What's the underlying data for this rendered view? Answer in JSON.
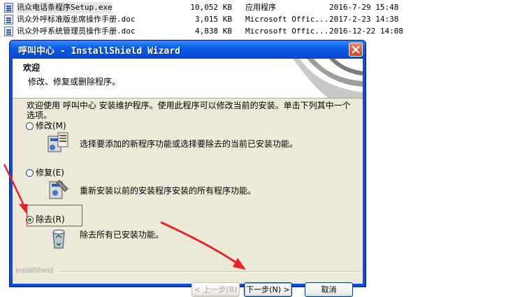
{
  "files": [
    {
      "name": "讯众电话条程序Setup.exe",
      "size": "10,052 KB",
      "type": "应用程序",
      "modified": "2016-7-29 15:48",
      "icon": "exe-file-icon",
      "selected": true
    },
    {
      "name": "讯众外呼标准版坐席操作手册.doc",
      "size": "3,015 KB",
      "type": "Microsoft Offic...",
      "modified": "2017-2-23 14:38",
      "icon": "word-doc-icon",
      "selected": false
    },
    {
      "name": "讯众外呼系统管理员操作手册.doc",
      "size": "4,838 KB",
      "type": "Microsoft Offic...",
      "modified": "2016-12-22 14:08",
      "icon": "word-doc-icon",
      "selected": false
    }
  ],
  "wizard": {
    "title": "呼叫中心 - InstallShield Wizard",
    "banner_heading": "欢迎",
    "banner_sub": "修改、修复或删除程序。",
    "intro": "欢迎使用 呼叫中心 安装维护程序。使用此程序可以修改当前的安装。单击下列其中一个选项。",
    "options": [
      {
        "label": "修改(M)",
        "description": "选择要添加的新程序功能或选择要除去的当前已安装功能。",
        "icon": "modify-setup-icon",
        "checked": false
      },
      {
        "label": "修复(E)",
        "description": "重新安装以前的安装程序安装的所有程序功能。",
        "icon": "repair-setup-icon",
        "checked": false
      },
      {
        "label": "除去(R)",
        "description": "除去所有已安装功能。",
        "icon": "remove-recycle-icon",
        "checked": true
      }
    ],
    "brand": "InstallShield",
    "buttons": {
      "back": "< 上一步(B)",
      "next": "下一步(N) >",
      "cancel": "取消"
    }
  },
  "colors": {
    "title_bar": "#0a5ce6",
    "highlight": "#e8232a",
    "dialog_bg": "#ece9d8"
  }
}
